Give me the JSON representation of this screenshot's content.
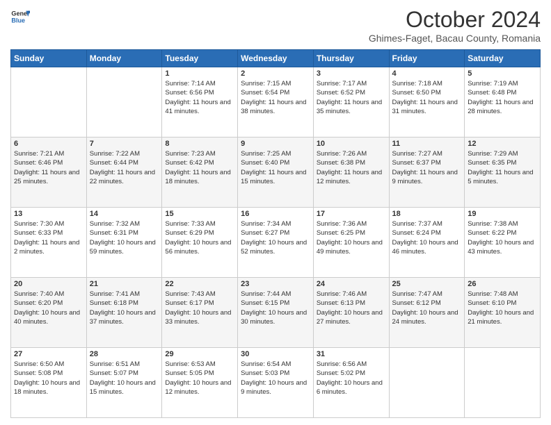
{
  "logo": {
    "general": "General",
    "blue": "Blue"
  },
  "title": "October 2024",
  "location": "Ghimes-Faget, Bacau County, Romania",
  "days_of_week": [
    "Sunday",
    "Monday",
    "Tuesday",
    "Wednesday",
    "Thursday",
    "Friday",
    "Saturday"
  ],
  "weeks": [
    [
      {
        "day": "",
        "info": ""
      },
      {
        "day": "",
        "info": ""
      },
      {
        "day": "1",
        "info": "Sunrise: 7:14 AM\nSunset: 6:56 PM\nDaylight: 11 hours and 41 minutes."
      },
      {
        "day": "2",
        "info": "Sunrise: 7:15 AM\nSunset: 6:54 PM\nDaylight: 11 hours and 38 minutes."
      },
      {
        "day": "3",
        "info": "Sunrise: 7:17 AM\nSunset: 6:52 PM\nDaylight: 11 hours and 35 minutes."
      },
      {
        "day": "4",
        "info": "Sunrise: 7:18 AM\nSunset: 6:50 PM\nDaylight: 11 hours and 31 minutes."
      },
      {
        "day": "5",
        "info": "Sunrise: 7:19 AM\nSunset: 6:48 PM\nDaylight: 11 hours and 28 minutes."
      }
    ],
    [
      {
        "day": "6",
        "info": "Sunrise: 7:21 AM\nSunset: 6:46 PM\nDaylight: 11 hours and 25 minutes."
      },
      {
        "day": "7",
        "info": "Sunrise: 7:22 AM\nSunset: 6:44 PM\nDaylight: 11 hours and 22 minutes."
      },
      {
        "day": "8",
        "info": "Sunrise: 7:23 AM\nSunset: 6:42 PM\nDaylight: 11 hours and 18 minutes."
      },
      {
        "day": "9",
        "info": "Sunrise: 7:25 AM\nSunset: 6:40 PM\nDaylight: 11 hours and 15 minutes."
      },
      {
        "day": "10",
        "info": "Sunrise: 7:26 AM\nSunset: 6:38 PM\nDaylight: 11 hours and 12 minutes."
      },
      {
        "day": "11",
        "info": "Sunrise: 7:27 AM\nSunset: 6:37 PM\nDaylight: 11 hours and 9 minutes."
      },
      {
        "day": "12",
        "info": "Sunrise: 7:29 AM\nSunset: 6:35 PM\nDaylight: 11 hours and 5 minutes."
      }
    ],
    [
      {
        "day": "13",
        "info": "Sunrise: 7:30 AM\nSunset: 6:33 PM\nDaylight: 11 hours and 2 minutes."
      },
      {
        "day": "14",
        "info": "Sunrise: 7:32 AM\nSunset: 6:31 PM\nDaylight: 10 hours and 59 minutes."
      },
      {
        "day": "15",
        "info": "Sunrise: 7:33 AM\nSunset: 6:29 PM\nDaylight: 10 hours and 56 minutes."
      },
      {
        "day": "16",
        "info": "Sunrise: 7:34 AM\nSunset: 6:27 PM\nDaylight: 10 hours and 52 minutes."
      },
      {
        "day": "17",
        "info": "Sunrise: 7:36 AM\nSunset: 6:25 PM\nDaylight: 10 hours and 49 minutes."
      },
      {
        "day": "18",
        "info": "Sunrise: 7:37 AM\nSunset: 6:24 PM\nDaylight: 10 hours and 46 minutes."
      },
      {
        "day": "19",
        "info": "Sunrise: 7:38 AM\nSunset: 6:22 PM\nDaylight: 10 hours and 43 minutes."
      }
    ],
    [
      {
        "day": "20",
        "info": "Sunrise: 7:40 AM\nSunset: 6:20 PM\nDaylight: 10 hours and 40 minutes."
      },
      {
        "day": "21",
        "info": "Sunrise: 7:41 AM\nSunset: 6:18 PM\nDaylight: 10 hours and 37 minutes."
      },
      {
        "day": "22",
        "info": "Sunrise: 7:43 AM\nSunset: 6:17 PM\nDaylight: 10 hours and 33 minutes."
      },
      {
        "day": "23",
        "info": "Sunrise: 7:44 AM\nSunset: 6:15 PM\nDaylight: 10 hours and 30 minutes."
      },
      {
        "day": "24",
        "info": "Sunrise: 7:46 AM\nSunset: 6:13 PM\nDaylight: 10 hours and 27 minutes."
      },
      {
        "day": "25",
        "info": "Sunrise: 7:47 AM\nSunset: 6:12 PM\nDaylight: 10 hours and 24 minutes."
      },
      {
        "day": "26",
        "info": "Sunrise: 7:48 AM\nSunset: 6:10 PM\nDaylight: 10 hours and 21 minutes."
      }
    ],
    [
      {
        "day": "27",
        "info": "Sunrise: 6:50 AM\nSunset: 5:08 PM\nDaylight: 10 hours and 18 minutes."
      },
      {
        "day": "28",
        "info": "Sunrise: 6:51 AM\nSunset: 5:07 PM\nDaylight: 10 hours and 15 minutes."
      },
      {
        "day": "29",
        "info": "Sunrise: 6:53 AM\nSunset: 5:05 PM\nDaylight: 10 hours and 12 minutes."
      },
      {
        "day": "30",
        "info": "Sunrise: 6:54 AM\nSunset: 5:03 PM\nDaylight: 10 hours and 9 minutes."
      },
      {
        "day": "31",
        "info": "Sunrise: 6:56 AM\nSunset: 5:02 PM\nDaylight: 10 hours and 6 minutes."
      },
      {
        "day": "",
        "info": ""
      },
      {
        "day": "",
        "info": ""
      }
    ]
  ]
}
